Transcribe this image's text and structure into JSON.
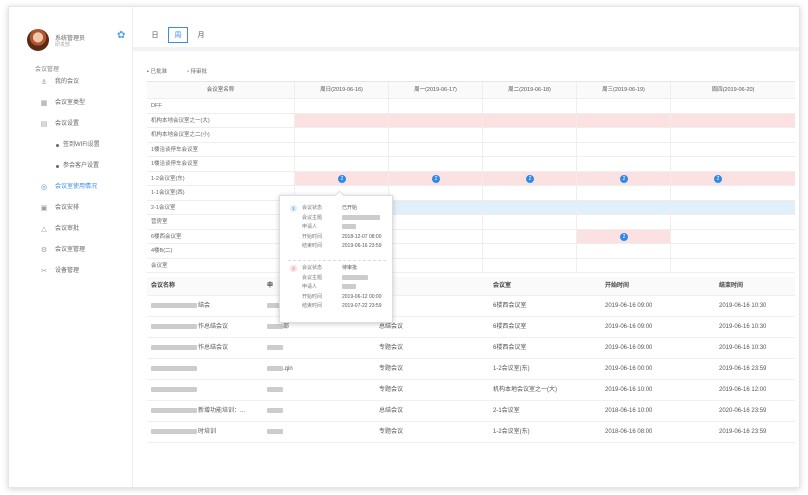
{
  "user": {
    "name": "系统管理员",
    "role": "研发部"
  },
  "nav": {
    "group_label": "会议管理",
    "items": [
      {
        "label": "我的会议",
        "icon": "calendar-icon"
      },
      {
        "label": "会议室类型",
        "icon": "grid-icon"
      },
      {
        "label": "会议设置",
        "icon": "settings-icon"
      },
      {
        "label": "签到WIFI设置",
        "sub": true
      },
      {
        "label": "参会客户设置",
        "sub": true
      },
      {
        "label": "会议室使用情况",
        "icon": "eye-icon",
        "active": true
      },
      {
        "label": "会议安排",
        "icon": "list-icon"
      },
      {
        "label": "会议审批",
        "icon": "warning-icon"
      },
      {
        "label": "会议室管理",
        "icon": "settings-icon"
      },
      {
        "label": "设备管理",
        "icon": "device-icon"
      }
    ]
  },
  "view_tabs": [
    "日",
    "周",
    "月"
  ],
  "legend": {
    "approved": "已批准",
    "pending": "待审批"
  },
  "schedule": {
    "room_header": "会议室名称",
    "days": [
      "周日(2019-06-16)",
      "周一(2019-06-17)",
      "周二(2019-06-18)",
      "周三(2019-06-19)",
      "周四(2019-06-20)"
    ],
    "rooms": [
      "DFF",
      "机构本地会议室之一(大)",
      "机构本地会议室之二(小)",
      "1楼洽谈停车会议室",
      "1楼洽谈停车会议室",
      "1-2会议室(东)",
      "1-1会议室(西)",
      "2-1会议室",
      "营房室",
      "6楼西会议室",
      "4楼B(二)",
      "会议室"
    ],
    "badge_label": "2"
  },
  "popup": {
    "labels": [
      "会议状态",
      "会议主题",
      "申请人",
      "开始时间",
      "结束时间"
    ],
    "first": [
      "已开始",
      "",
      "",
      "2018-12-07 08:00",
      "2019-06-16 23:59"
    ],
    "second": [
      "待审批",
      "",
      "",
      "2019-06-12 00:00",
      "2019-07-22 23:59"
    ],
    "num1": "1",
    "num2": "2"
  },
  "table": {
    "headers": [
      "会议名称",
      "申",
      "",
      "会议室",
      "开始时间",
      "结束时间"
    ],
    "rows": [
      [
        "结会",
        "",
        "",
        "6楼西会议室",
        "2019-06-16 09:00",
        "2019-06-16 10:30"
      ],
      [
        "作总结会议",
        "部",
        "总结会议",
        "6楼西会议室",
        "2019-06-16 09:00",
        "2019-06-16 10:30"
      ],
      [
        "作总结会议",
        "",
        "专题会议",
        "6楼西会议室",
        "2019-06-16 09:00",
        "2019-06-16 10:30"
      ],
      [
        "",
        ".qin",
        "专题会议",
        "1-2会议室(东)",
        "2019-06-16 00:00",
        "2019-06-16 23:59"
      ],
      [
        "",
        "",
        "专题会议",
        "机构本地会议室之一(大)",
        "2019-06-16 10:00",
        "2019-06-16 12:00"
      ],
      [
        "新增功能培训：...",
        "",
        "总结会议",
        "2-1会议室",
        "2018-06-16 10:00",
        "2020-06-16 23:59"
      ],
      [
        "时培训",
        "",
        "专题会议",
        "1-2会议室(东)",
        "2018-06-16 08:00",
        "2019-06-16 23:59"
      ]
    ]
  },
  "colors": {
    "accent": "#3a8ee6",
    "approved_band": "#fbe1e1",
    "pending_band": "#dff0fb"
  }
}
